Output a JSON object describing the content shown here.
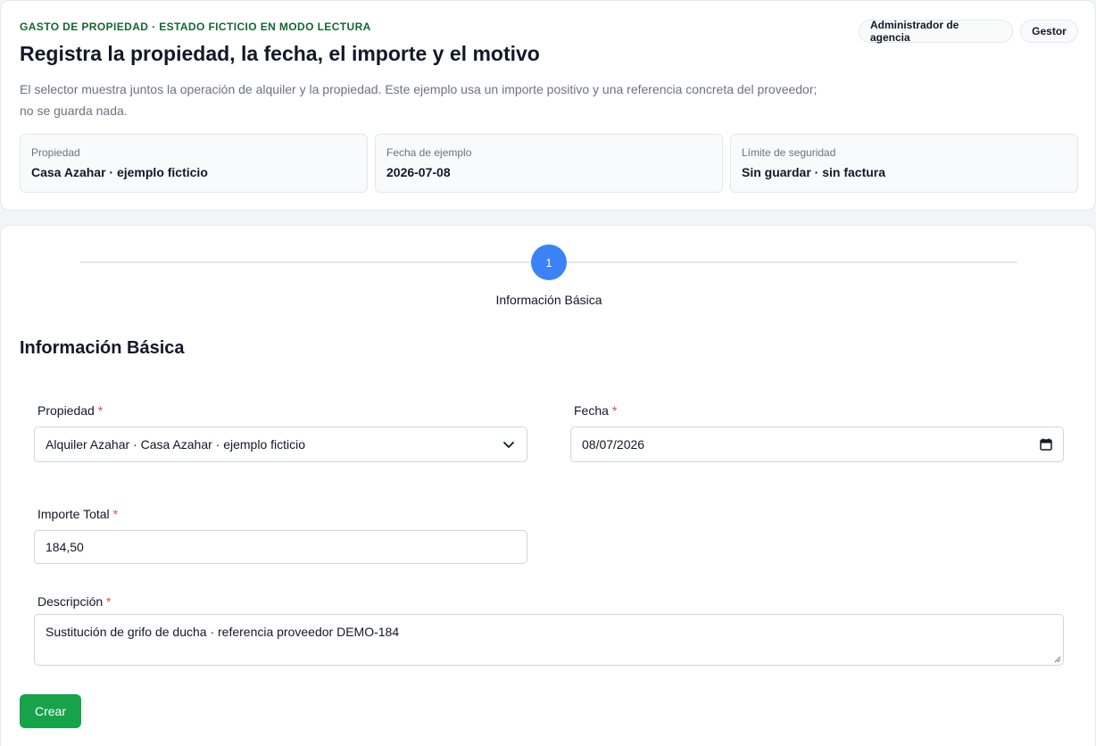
{
  "header": {
    "eyebrow": "GASTO DE PROPIEDAD · ESTADO FICTICIO EN MODO LECTURA",
    "title": "Registra la propiedad, la fecha, el importe y el motivo",
    "description_line1": "El selector muestra juntos la operación de alquiler y la propiedad. Este ejemplo usa un importe positivo y una referencia concreta del proveedor;",
    "description_line2": "no se guarda nada.",
    "roles": [
      "Administrador de agencia",
      "Gestor"
    ]
  },
  "info_boxes": [
    {
      "label": "Propiedad",
      "value": "Casa Azahar · ejemplo ficticio"
    },
    {
      "label": "Fecha de ejemplo",
      "value": "2026-07-08"
    },
    {
      "label": "Límite de seguridad",
      "value": "Sin guardar · sin factura"
    }
  ],
  "stepper": {
    "step_number": "1",
    "step_label": "Información Básica"
  },
  "form": {
    "section_title": "Información Básica",
    "required_marker": "*",
    "property": {
      "label": "Propiedad",
      "value": "Alquiler Azahar · Casa Azahar · ejemplo ficticio",
      "icon": "chevron-down-icon"
    },
    "date": {
      "label": "Fecha",
      "value": "08/07/2026",
      "icon": "calendar-icon"
    },
    "amount": {
      "label": "Importe Total",
      "value": "184,50"
    },
    "description": {
      "label": "Descripción",
      "value": "Sustitución de grifo de ducha · referencia proveedor DEMO-184"
    },
    "submit_label": "Crear"
  },
  "colors": {
    "eyebrow": "#166534",
    "step_active": "#3b82f6",
    "submit": "#16a34a",
    "required": "#ef4444"
  }
}
